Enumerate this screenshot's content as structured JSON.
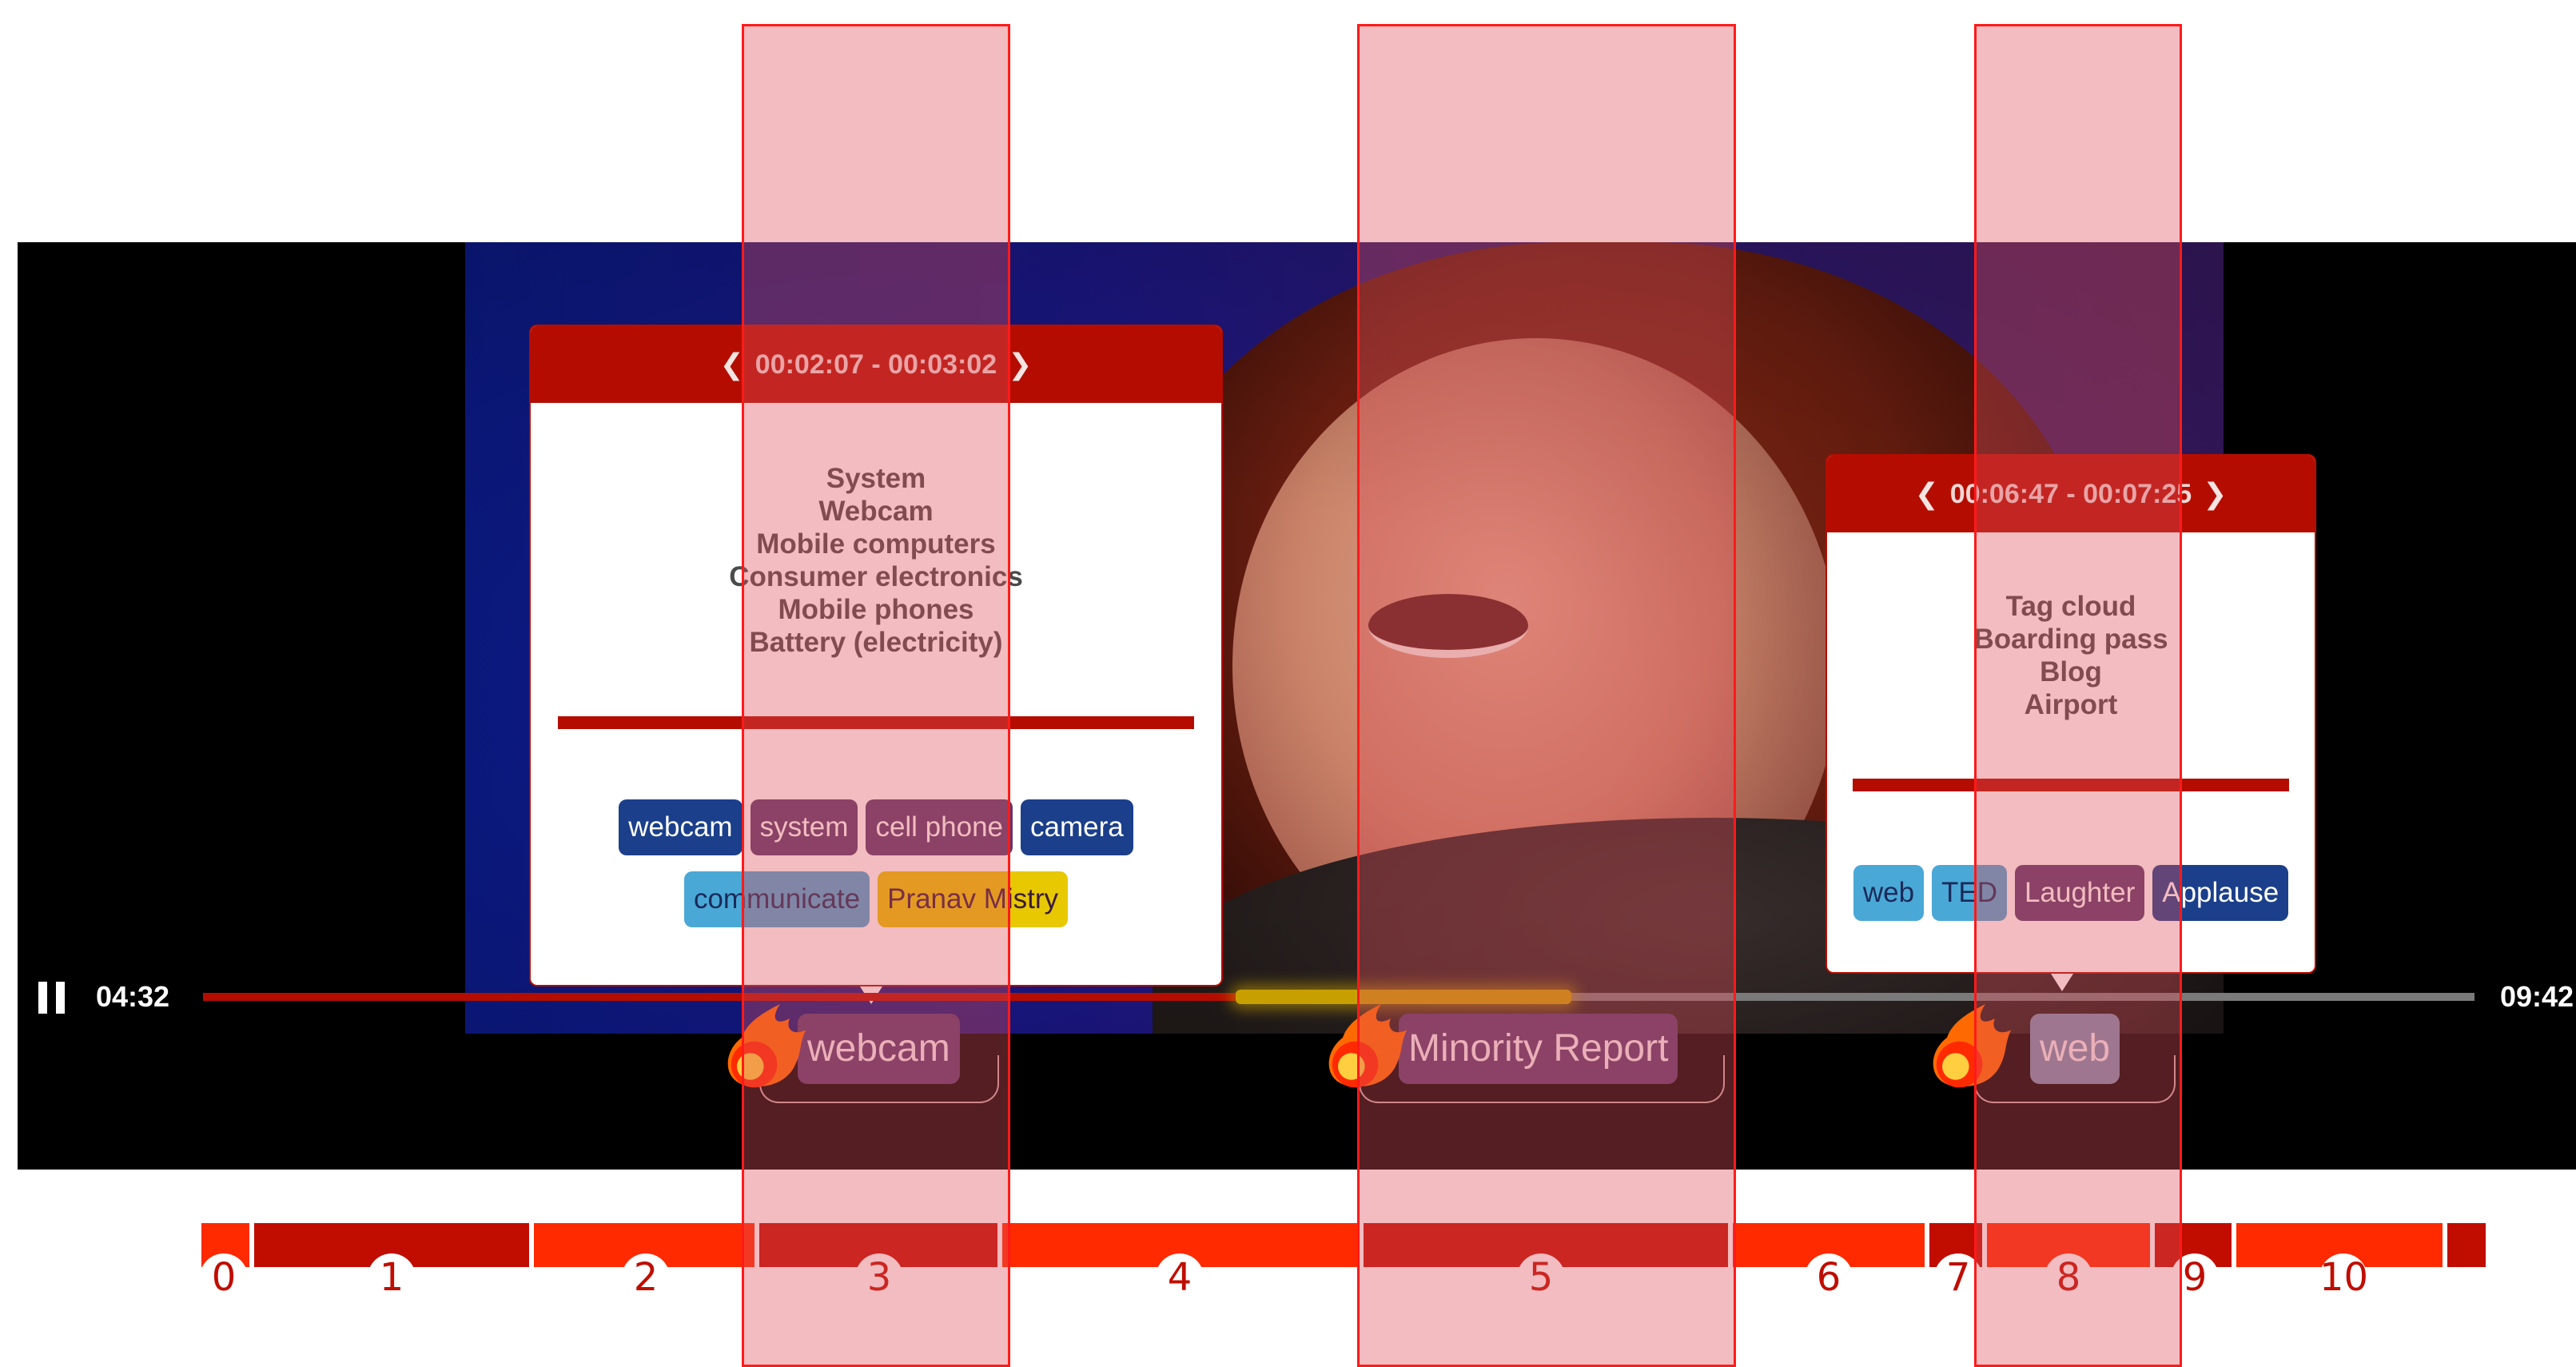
{
  "player": {
    "current_time": "04:32",
    "duration": "09:42",
    "progress_fraction": 0.467
  },
  "popups": [
    {
      "range": "00:02:07 - 00:03:02",
      "topics": [
        "System",
        "Webcam",
        "Mobile computers",
        "Consumer electronics",
        "Mobile phones",
        "Battery (electricity)"
      ],
      "tag_rows": [
        [
          {
            "label": "webcam",
            "color": "#1b3f8a"
          },
          {
            "label": "system",
            "color": "#5a3a6e"
          },
          {
            "label": "cell phone",
            "color": "#5a3a6e"
          },
          {
            "label": "camera",
            "color": "#1b3f8a"
          }
        ],
        [
          {
            "label": "communicate",
            "color": "#4aa8d6"
          },
          {
            "label": "Pranav Mistry",
            "color": "#e8c800"
          }
        ]
      ]
    },
    {
      "range": "00:06:47 - 00:07:25",
      "topics": [
        "Tag cloud",
        "Boarding pass",
        "Blog",
        "Airport"
      ],
      "tag_rows": [
        [
          {
            "label": "web",
            "color": "#4aa8d6"
          },
          {
            "label": "TED",
            "color": "#4aa8d6"
          },
          {
            "label": "Laughter",
            "color": "#5a3a6e"
          },
          {
            "label": "Applause",
            "color": "#1b3f8a"
          }
        ]
      ]
    }
  ],
  "badges": [
    {
      "label": "webcam",
      "color": "#5a3a6e"
    },
    {
      "label": "Minority Report",
      "color": "#5a3a6e"
    },
    {
      "label": "web",
      "color": "#7a8fb0"
    }
  ],
  "timeline": {
    "segments": [
      "0",
      "1",
      "2",
      "3",
      "4",
      "5",
      "6",
      "7",
      "8",
      "9",
      "10"
    ],
    "colors": {
      "bright": "#ff2a00",
      "dark": "#c00d00"
    }
  },
  "icons": {
    "pause": "pause-icon",
    "prev": "chevron-left-icon",
    "next": "chevron-right-icon",
    "flame": "fireball-icon"
  }
}
